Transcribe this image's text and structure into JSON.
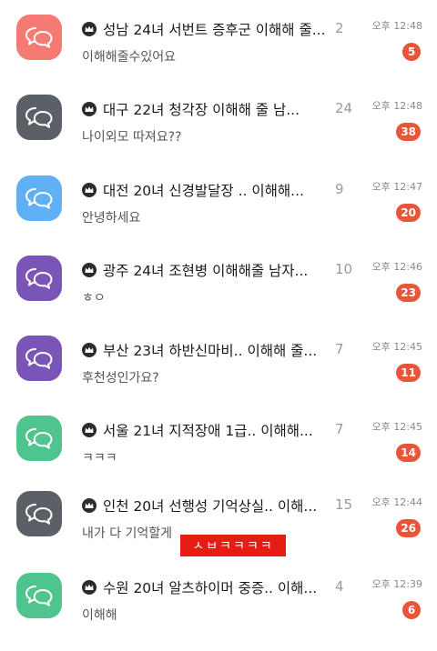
{
  "chats": [
    {
      "title": "성남 24녀 서번트 증후군 이해해 줄...",
      "members": "2",
      "preview": "이해해줄수있어요",
      "time": "오후 12:48",
      "unread": "5",
      "avatar_color": "#f47a73",
      "avatar_icon": "speech-bubbles-icon"
    },
    {
      "title": "대구 22녀 청각장   이해해 줄 남...",
      "members": "24",
      "preview": "나이외모 따져요??",
      "time": "오후 12:48",
      "unread": "38",
      "avatar_color": "#5b6066",
      "avatar_icon": "speech-bubbles-icon"
    },
    {
      "title": "대전 20녀 신경발달장  .. 이해해...",
      "members": "9",
      "preview": "안녕하세요",
      "time": "오후 12:47",
      "unread": "20",
      "avatar_color": "#5fb0f4",
      "avatar_icon": "speech-bubbles-icon"
    },
    {
      "title": "광주 24녀 조현병 이해해줄 남자...",
      "members": "10",
      "preview": "ㅎㅇ",
      "time": "오후 12:46",
      "unread": "23",
      "avatar_color": "#7a55b8",
      "avatar_icon": "speech-bubbles-icon"
    },
    {
      "title": "부산 23녀 하반신마비.. 이해해 줄...",
      "members": "7",
      "preview": "후천성인가요?",
      "time": "오후 12:45",
      "unread": "11",
      "avatar_color": "#7a55b8",
      "avatar_icon": "speech-bubbles-icon"
    },
    {
      "title": "서울 21녀 지적장애 1급.. 이해해...",
      "members": "7",
      "preview": "ㅋㅋㅋ",
      "time": "오후 12:45",
      "unread": "14",
      "avatar_color": "#4fc48f",
      "avatar_icon": "speech-bubbles-icon"
    },
    {
      "title": "인천 20녀 선행성 기억상실.. 이해...",
      "members": "15",
      "preview": "내가 다 기억할게",
      "time": "오후 12:44",
      "unread": "26",
      "avatar_color": "#5b6066",
      "avatar_icon": "speech-bubbles-icon"
    },
    {
      "title": "수원 20녀 알츠하이머 중증.. 이해...",
      "members": "4",
      "preview": "이해해",
      "time": "오후 12:39",
      "unread": "6",
      "avatar_color": "#4fc48f",
      "avatar_icon": "speech-bubbles-icon"
    }
  ],
  "caption": "ㅅㅂㅋㅋㅋㅋ",
  "caption_color": "#e51d14",
  "badge_color": "#e8553a",
  "crown_icon": "crown-icon"
}
